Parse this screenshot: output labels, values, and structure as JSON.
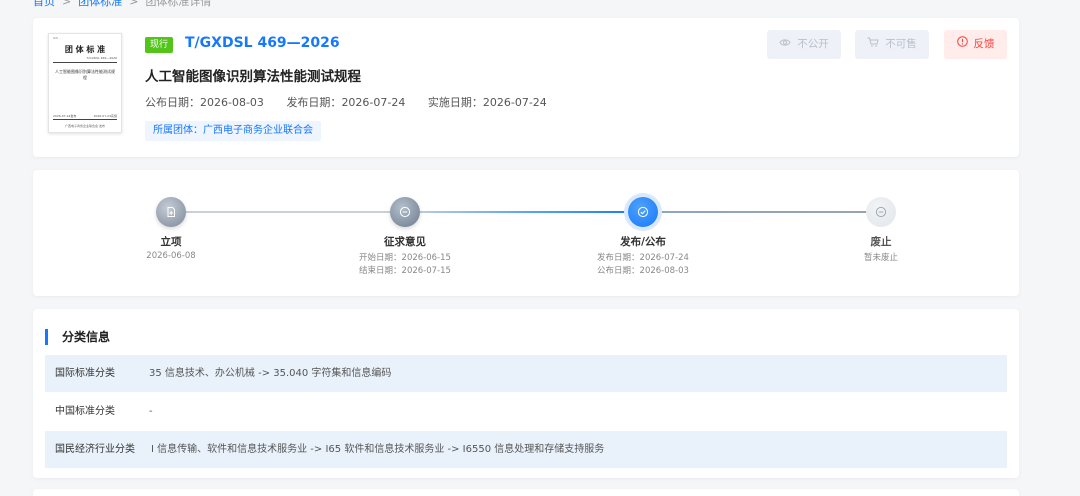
{
  "breadcrumb": {
    "home": "首页",
    "groups": "团体标准",
    "current": "团体标准详情",
    "sep": ">"
  },
  "standard": {
    "status": "现行",
    "code": "T/GXDSL 469—2026",
    "title": "人工智能图像识别算法性能测试规程",
    "dates": {
      "publish_label": "公布日期：",
      "publish": "2026-08-03",
      "release_label": "发布日期：",
      "release": "2026-07-24",
      "implement_label": "实施日期：",
      "implement": "2026-07-24"
    },
    "org": "所属团体：广西电子商务企业联合会"
  },
  "thumbnail": {
    "top": "ICS  ··",
    "heading": "团 体 标 准",
    "code": "T/GXDSL 469—2026",
    "title": "人工智能图像识别算法性能测试规程",
    "release_date": "2026-07-24发布",
    "implement_date": "2026-07-24实施",
    "footer": "广西电子商务企业联合会  发布"
  },
  "actions": {
    "private": "不公开",
    "not_for_sale": "不可售",
    "feedback": "反馈"
  },
  "timeline": {
    "steps": [
      {
        "label": "立项",
        "lines": [
          "2026-06-08"
        ]
      },
      {
        "label": "征求意见",
        "lines": [
          "开始日期：2026-06-15",
          "结束日期：2026-07-15"
        ]
      },
      {
        "label": "发布/公布",
        "lines": [
          "发布日期：2026-07-24",
          "公布日期：2026-08-03"
        ]
      },
      {
        "label": "废止",
        "lines": [
          "暂未废止"
        ]
      }
    ]
  },
  "category": {
    "section_title": "分类信息",
    "rows": [
      {
        "key": "国际标准分类",
        "value": "35 信息技术、办公机械 -> 35.040 字符集和信息编码"
      },
      {
        "key": "中国标准分类",
        "value": "-"
      },
      {
        "key": "国民经济行业分类",
        "value": "I 信息传输、软件和信息技术服务业 -> I65 软件和信息技术服务业 -> I6550 信息处理和存储支持服务"
      }
    ]
  },
  "colors": {
    "accent": "#1677ff",
    "status_green": "#52c41a",
    "feedback_red": "#f5453d"
  },
  "icons": [
    "eye-icon",
    "cart-icon",
    "alert-circle-icon",
    "file-plus-icon",
    "comment-icon",
    "check-icon",
    "minus-circle-icon"
  ]
}
